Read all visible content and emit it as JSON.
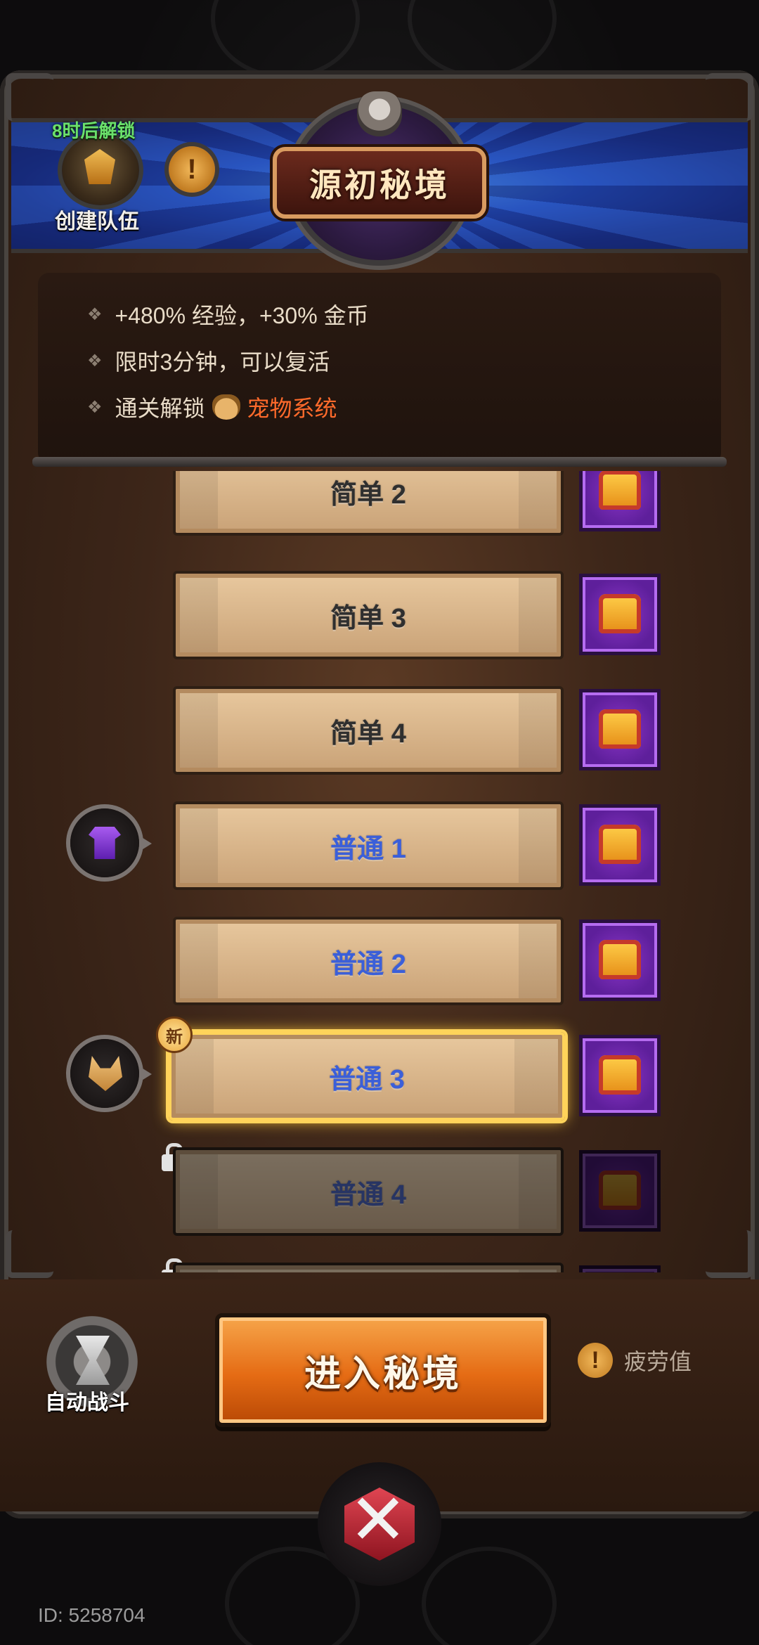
{
  "header": {
    "title": "源初秘境",
    "unlock_timer": "8时后解锁",
    "team_label": "创建队伍",
    "info_icon": "!"
  },
  "info": {
    "line1": "+480% 经验，+30% 金币",
    "line2": "限时3分钟，可以复活",
    "line3_prefix": "通关解锁",
    "line3_accent": "宠物系统",
    "bullet": "❖"
  },
  "levels": [
    {
      "label": "简单 2",
      "difficulty": "easy"
    },
    {
      "label": "简单 3",
      "difficulty": "easy"
    },
    {
      "label": "简单 4",
      "difficulty": "easy"
    },
    {
      "label": "普通 1",
      "difficulty": "normal",
      "reward": "shirt-icon"
    },
    {
      "label": "普通 2",
      "difficulty": "normal"
    },
    {
      "label": "普通 3",
      "difficulty": "normal",
      "reward": "pet-icon",
      "selected": true,
      "badge": "新"
    },
    {
      "label": "普通 4",
      "difficulty": "normal",
      "locked": true
    }
  ],
  "controls": {
    "auto_battle": "自动战斗",
    "enter": "进入秘境",
    "fatigue": "疲劳值",
    "fatigue_icon": "!"
  },
  "footer": {
    "user_id": "ID: 5258704"
  },
  "colors": {
    "accent_orange": "#e56b14",
    "normal_blue": "#3b5fd9",
    "pet_system_red": "#ff6a2b",
    "unlock_green": "#6be06b"
  }
}
